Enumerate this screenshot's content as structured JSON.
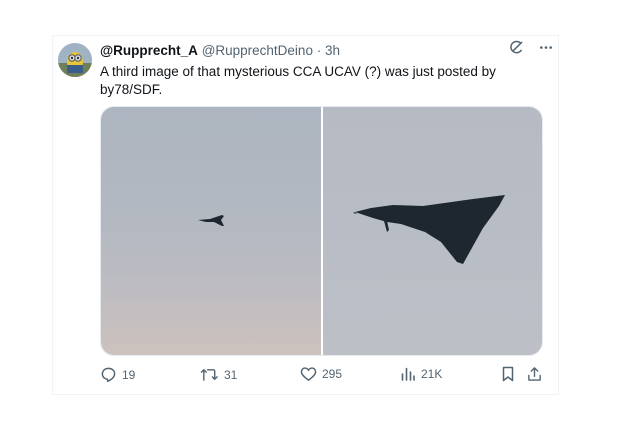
{
  "tweet": {
    "display_name": "@Rupprecht_A",
    "handle": "@RupprechtDeino",
    "separator": "·",
    "time": "3h",
    "text": "A third image of that mysterious CCA UCAV (?) was just posted by by78/SDF."
  },
  "header_icons": [
    "grok-icon",
    "more-icon"
  ],
  "media": {
    "images": [
      {
        "subject": "distant aircraft in grey sky"
      },
      {
        "subject": "close-up of tailless aircraft in grey sky"
      }
    ]
  },
  "actions": {
    "replies": "19",
    "retweets": "31",
    "likes": "295",
    "views": "21K"
  },
  "colors": {
    "text_primary": "#0f1419",
    "text_secondary": "#536471",
    "border": "#eff3f4"
  }
}
